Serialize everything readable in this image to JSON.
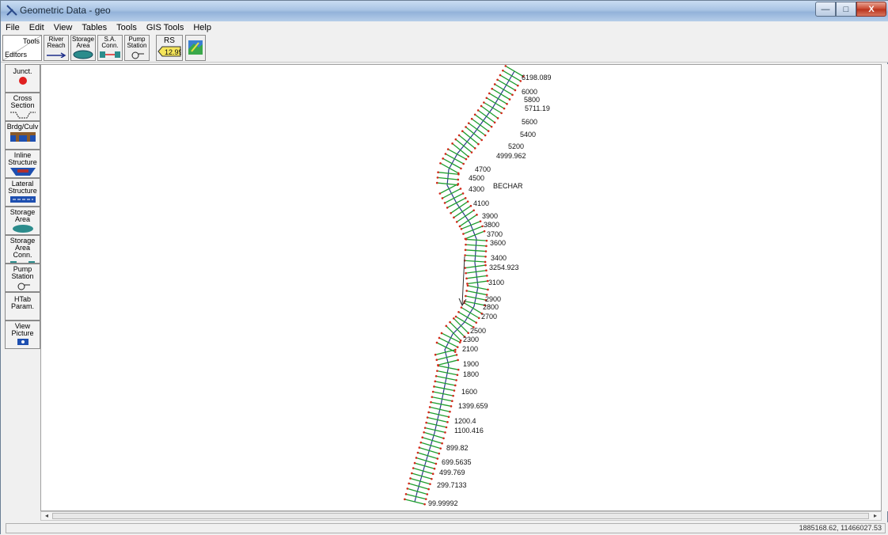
{
  "window": {
    "title": "Geometric Data - geo",
    "minimize": "—",
    "maximize": "□",
    "close": "X"
  },
  "menu": [
    "File",
    "Edit",
    "View",
    "Tables",
    "Tools",
    "GIS Tools",
    "Help"
  ],
  "toolbar": {
    "tools_label": "Tools",
    "editors_label": "Editors",
    "river_reach": [
      "River",
      "Reach"
    ],
    "storage_area": [
      "Storage",
      "Area"
    ],
    "sa_conn": [
      "S.A.",
      "Conn."
    ],
    "pump_station": [
      "Pump",
      "Station"
    ],
    "rs_label": "RS",
    "rs_value": "12.99"
  },
  "palette": [
    {
      "key": "junct",
      "lines": [
        "Junct."
      ]
    },
    {
      "key": "cross_section",
      "lines": [
        "Cross",
        "Section"
      ]
    },
    {
      "key": "brdg_culv",
      "lines": [
        "Brdg/Culv"
      ]
    },
    {
      "key": "inline_structure",
      "lines": [
        "Inline",
        "Structure"
      ]
    },
    {
      "key": "lateral_structure",
      "lines": [
        "Lateral",
        "Structure"
      ]
    },
    {
      "key": "storage_area",
      "lines": [
        "Storage",
        "Area"
      ]
    },
    {
      "key": "storage_area_conn",
      "lines": [
        "Storage",
        "Area Conn."
      ]
    },
    {
      "key": "pump_station",
      "lines": [
        "Pump",
        "Station"
      ]
    },
    {
      "key": "htab_param",
      "lines": [
        "HTab",
        "Param."
      ]
    },
    {
      "key": "view_picture",
      "lines": [
        "View",
        "Picture"
      ]
    }
  ],
  "river": {
    "name": "BECHAR"
  },
  "cross_sections": [
    "6198.089",
    "6000",
    "5800",
    "5711.19",
    "5600",
    "5400",
    "5200",
    "4999.962",
    "4700",
    "4500",
    "4300",
    "4100",
    "3900",
    "3800",
    "3700",
    "3600",
    "3400",
    "3254.923",
    "3100",
    "2900",
    "2800",
    "2700",
    "2500",
    "2300",
    "2100",
    "1900",
    "1800",
    "1600",
    "1399.659",
    "1200.4",
    "1100.416",
    "899.82",
    "699.5635",
    "499.769",
    "299.7133",
    "99.99992"
  ],
  "status": {
    "coords": "1885168.62, 11466027.53"
  },
  "colors": {
    "river": "#2a3a8a",
    "xs_bank_left": "#1e9e2e",
    "xs_bank_right": "#1e9e2e",
    "bank_marker": "#d22a1a"
  }
}
